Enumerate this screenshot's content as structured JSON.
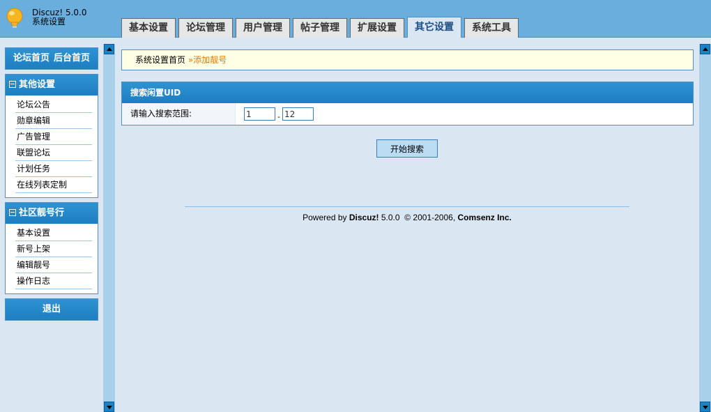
{
  "header": {
    "app_name": "Discuz! 5.0.0",
    "subtitle": "系统设置",
    "tabs": [
      {
        "label": "基本设置",
        "active": false
      },
      {
        "label": "论坛管理",
        "active": false
      },
      {
        "label": "用户管理",
        "active": false
      },
      {
        "label": "帖子管理",
        "active": false
      },
      {
        "label": "扩展设置",
        "active": false
      },
      {
        "label": "其它设置",
        "active": true
      },
      {
        "label": "系统工具",
        "active": false
      }
    ]
  },
  "sidebar": {
    "quick_links": [
      "论坛首页",
      "后台首页"
    ],
    "sections": [
      {
        "title": "其他设置",
        "items": [
          "论坛公告",
          "勋章编辑",
          "广告管理",
          "联盟论坛",
          "计划任务",
          "在线列表定制"
        ]
      },
      {
        "title": "社区靓号行",
        "items": [
          "基本设置",
          "新号上架",
          "编辑靓号",
          "操作日志"
        ]
      }
    ],
    "logout_label": "退出"
  },
  "breadcrumb": {
    "home": "系统设置首页",
    "separator": "»",
    "current": "添加靓号"
  },
  "panel": {
    "title": "搜索闲置UID",
    "row_label": "请输入搜索范围:",
    "range_from": "1",
    "range_to": "12",
    "range_dash": "-"
  },
  "submit_label": "开始搜索",
  "footer": {
    "powered_by": "Powered by",
    "brand": "Discuz!",
    "version": "5.0.0",
    "copyright": "© 2001-2006,",
    "company": "Comsenz Inc."
  },
  "colors": {
    "header_bg": "#6aaede",
    "accent_blue": "#1d7ec0",
    "page_bg": "#dbe6f3",
    "breadcrumb_bg": "#ffffe6",
    "breadcrumb_current": "#e07a00"
  }
}
